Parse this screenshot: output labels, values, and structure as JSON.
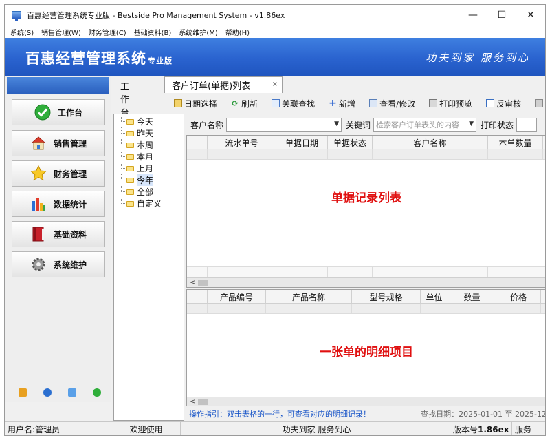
{
  "window": {
    "title": "百惠经营管理系统专业版 - Bestside Pro Management System - v1.86ex",
    "controls": [
      "—",
      "☐",
      "✕"
    ]
  },
  "menu": [
    "系统(S)",
    "销售管理(W)",
    "财务管理(C)",
    "基础资料(B)",
    "系统维护(M)",
    "帮助(H)"
  ],
  "banner": {
    "title": "百惠经营管理系统",
    "title_suffix": "专业版",
    "slogan": "功夫到家 服务到心"
  },
  "sidebar": {
    "items": [
      {
        "label": "工作台",
        "icon": "checkmark-icon"
      },
      {
        "label": "销售管理",
        "icon": "house-icon"
      },
      {
        "label": "财务管理",
        "icon": "star-icon"
      },
      {
        "label": "数据统计",
        "icon": "bar-chart-icon"
      },
      {
        "label": "基础资料",
        "icon": "book-icon"
      },
      {
        "label": "系统维护",
        "icon": "gear-icon"
      }
    ],
    "bottom_icons": [
      "key-icon",
      "clock-icon",
      "search-icon",
      "refresh-icon"
    ]
  },
  "tabs": {
    "plain": "工作台",
    "active": "客户订单(单据)列表",
    "close": "×"
  },
  "toolbar": [
    {
      "label": "日期选择",
      "icon": "calendar-icon"
    },
    {
      "label": "刷新",
      "icon": "refresh-icon"
    },
    {
      "label": "关联查找",
      "icon": "find-icon"
    },
    {
      "label": "新增",
      "icon": "plus-icon"
    },
    {
      "label": "查看/修改",
      "icon": "view-icon"
    },
    {
      "label": "打印预览",
      "icon": "print-icon"
    },
    {
      "label": "反审核",
      "icon": "unaudit-icon"
    },
    {
      "label": "",
      "icon": "delete-icon"
    }
  ],
  "tree": {
    "items": [
      "今天",
      "昨天",
      "本周",
      "本月",
      "上月",
      "今年",
      "全部",
      "自定义"
    ],
    "selected": "今年"
  },
  "filter": {
    "customer_label": "客户名称",
    "customer_value": "",
    "keyword_label": "关键词",
    "keyword_placeholder": "检索客户订单表头的内容",
    "print_label": "打印状态"
  },
  "master_grid": {
    "columns": [
      "",
      "流水单号",
      "单据日期",
      "单据状态",
      "客户名称",
      "本单数量"
    ],
    "note": "单据记录列表"
  },
  "detail_grid": {
    "columns": [
      "",
      "产品编号",
      "产品名称",
      "型号规格",
      "单位",
      "数量",
      "价格"
    ],
    "note": "一张单的明细项目"
  },
  "hint": {
    "text": "操作指引：双击表格的一行，可查看对应的明细记录！",
    "date_range": "查找日期：2025-01-01 至 2025-12"
  },
  "status": {
    "user": "用户名:管理员",
    "welcome": "欢迎使用",
    "slogan": "功夫到家 服务到心",
    "version_label": "版本号",
    "version": "1.86ex",
    "service": "服务"
  },
  "colors": {
    "banner": "#2a63cf",
    "note_red": "#e01010",
    "hint_blue": "#1a56c8"
  }
}
